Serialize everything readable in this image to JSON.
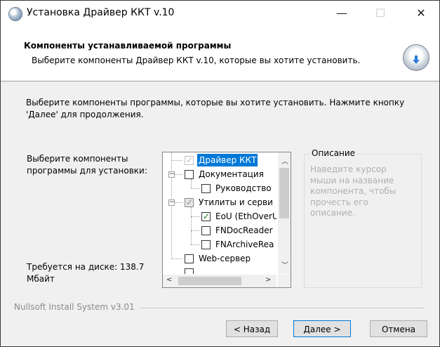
{
  "window": {
    "title": "Установка Драйвер ККТ v.10",
    "minimize_glyph": "—",
    "maximize_glyph": "☐",
    "close_glyph": "✕"
  },
  "header": {
    "title": "Компоненты устанавливаемой программы",
    "subtitle": "Выберите компоненты Драйвер ККТ v.10, которые вы хотите установить."
  },
  "intro": {
    "line1": "Выберите компоненты программы, которые вы хотите установить. Нажмите кнопку",
    "line2": "'Далее' для продолжения."
  },
  "select_label": {
    "line1": "Выберите компоненты",
    "line2": "программы для установки:"
  },
  "disk": {
    "line1": "Требуется на диске: 138.7",
    "line2": "Мбайт"
  },
  "tree": {
    "items": [
      {
        "label": "Драйвер ККТ",
        "checked": true,
        "state": "disabled-selected"
      },
      {
        "label": "Документация",
        "checked": false
      },
      {
        "label": "Руководство",
        "checked": false
      },
      {
        "label": "Утилиты и серви",
        "checked": true,
        "state": "partial"
      },
      {
        "label": "EoU (EthOverU",
        "checked": true
      },
      {
        "label": "FNDocReader",
        "checked": false
      },
      {
        "label": "FNArchiveRea",
        "checked": false
      },
      {
        "label": "Web-сервер",
        "checked": false
      }
    ]
  },
  "description": {
    "title": "Описание",
    "text_lines": [
      "Наведите курсор",
      "мыши на название",
      "компонента, чтобы",
      "прочесть его",
      "описание."
    ]
  },
  "footer": {
    "brand": "Nullsoft Install System v3.01"
  },
  "buttons": {
    "back": "< Назад",
    "next": "Далее >",
    "cancel": "Отмена"
  },
  "colors": {
    "selection": "#0078d7",
    "check": "#1a7a1a"
  }
}
